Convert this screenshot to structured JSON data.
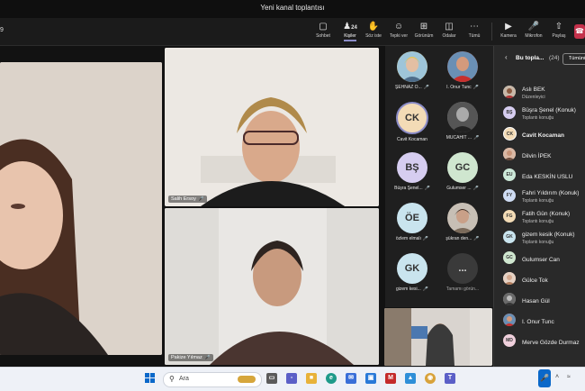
{
  "window": {
    "title": "Yeni kanal toplantısı"
  },
  "toolbar": {
    "timer": "9",
    "buttons": [
      {
        "label": "Sohbet",
        "icon": "chat-icon"
      },
      {
        "label": "Kişiler",
        "icon": "people-icon",
        "count": "24"
      },
      {
        "label": "Söz iste",
        "icon": "raise-hand-icon"
      },
      {
        "label": "Tepki ver",
        "icon": "reaction-icon"
      },
      {
        "label": "Görünüm",
        "icon": "view-icon"
      },
      {
        "label": "Odalar",
        "icon": "breakout-rooms-icon"
      },
      {
        "label": "Tümü",
        "icon": "more-icon"
      },
      {
        "label": "Kamera",
        "icon": "camera-icon"
      },
      {
        "label": "Mikrofon",
        "icon": "microphone-icon"
      },
      {
        "label": "Paylaş",
        "icon": "share-icon"
      }
    ]
  },
  "stage": {
    "tiles": [
      {
        "name": "Salih Ersoy"
      },
      {
        "name": "Pakize Yılmaz"
      }
    ]
  },
  "grid": [
    {
      "name": "ŞEHNAZ Ö...",
      "initials": "",
      "color": "#f2c85b"
    },
    {
      "name": "I. Onur Tunc",
      "initials": "",
      "color": "#c8502e"
    },
    {
      "name": "Cavit Kocaman",
      "initials": "CK",
      "color": "#f3dbb6"
    },
    {
      "name": "MÜCAHİT ...",
      "initials": "",
      "color": "#888888"
    },
    {
      "name": "Büşra Şenel...",
      "initials": "BŞ",
      "color": "#d6cdf0"
    },
    {
      "name": "Gulumser ...",
      "initials": "GC",
      "color": "#cfe6cf"
    },
    {
      "name": "özlem elmalı",
      "initials": "ÖE",
      "color": "#c9e4ee"
    },
    {
      "name": "şükran den...",
      "initials": "",
      "color": "#7a6a5a"
    },
    {
      "name": "gizem kesi...",
      "initials": "GK",
      "color": "#c9e4ee"
    },
    {
      "name": "Tamamı görün...",
      "initials": "...",
      "color": "#3a3a3a"
    }
  ],
  "panel": {
    "title": "Bu topla...",
    "count": "(24)",
    "mute_all": "Tümünü",
    "people": [
      {
        "name": "Aslı BEK",
        "role": "Düzenleyici",
        "initials": "AB",
        "color": "#d7d7d7"
      },
      {
        "name": "Büşra Şenel (Konuk)",
        "role": "Toplantı konuğu",
        "initials": "BŞ",
        "color": "#d6cdf0"
      },
      {
        "name": "Cavit Kocaman",
        "role": "",
        "initials": "CK",
        "color": "#f3dbb6"
      },
      {
        "name": "Dilvin İPEK",
        "role": "",
        "initials": "Dİ",
        "color": "#e8b9a8"
      },
      {
        "name": "Eda KESKİN USLU",
        "role": "",
        "initials": "EU",
        "color": "#cde9d9"
      },
      {
        "name": "Fahri Yıldırım (Konuk)",
        "role": "Toplantı konuğu",
        "initials": "FY",
        "color": "#cfdcf3"
      },
      {
        "name": "Fatih Gün (Konuk)",
        "role": "Toplantı konuğu",
        "initials": "FG",
        "color": "#f3dcb6"
      },
      {
        "name": "gizem kesik (Konuk)",
        "role": "Toplantı konuğu",
        "initials": "GK",
        "color": "#c9e4ee"
      },
      {
        "name": "Gulumser Can",
        "role": "",
        "initials": "GC",
        "color": "#cfe6cf"
      },
      {
        "name": "Gülce Tok",
        "role": "",
        "initials": "GT",
        "color": "#e9c3b2"
      },
      {
        "name": "Hasan Gül",
        "role": "",
        "initials": "HG",
        "color": "#9a9a9a"
      },
      {
        "name": "I. Onur Tunc",
        "role": "",
        "initials": "IT",
        "color": "#c8502e"
      },
      {
        "name": "Merve Gözde Durmaz",
        "role": "",
        "initials": "MD",
        "color": "#f0d0dc"
      }
    ]
  },
  "taskbar": {
    "search_text": "Ara",
    "apps": [
      "task-view",
      "teams-chat",
      "file-explorer",
      "edge",
      "mail",
      "store",
      "mcafee",
      "photos",
      "chrome",
      "teams"
    ]
  },
  "colors": {
    "leave": "#c4314b",
    "accent": "#8b8cc7"
  }
}
